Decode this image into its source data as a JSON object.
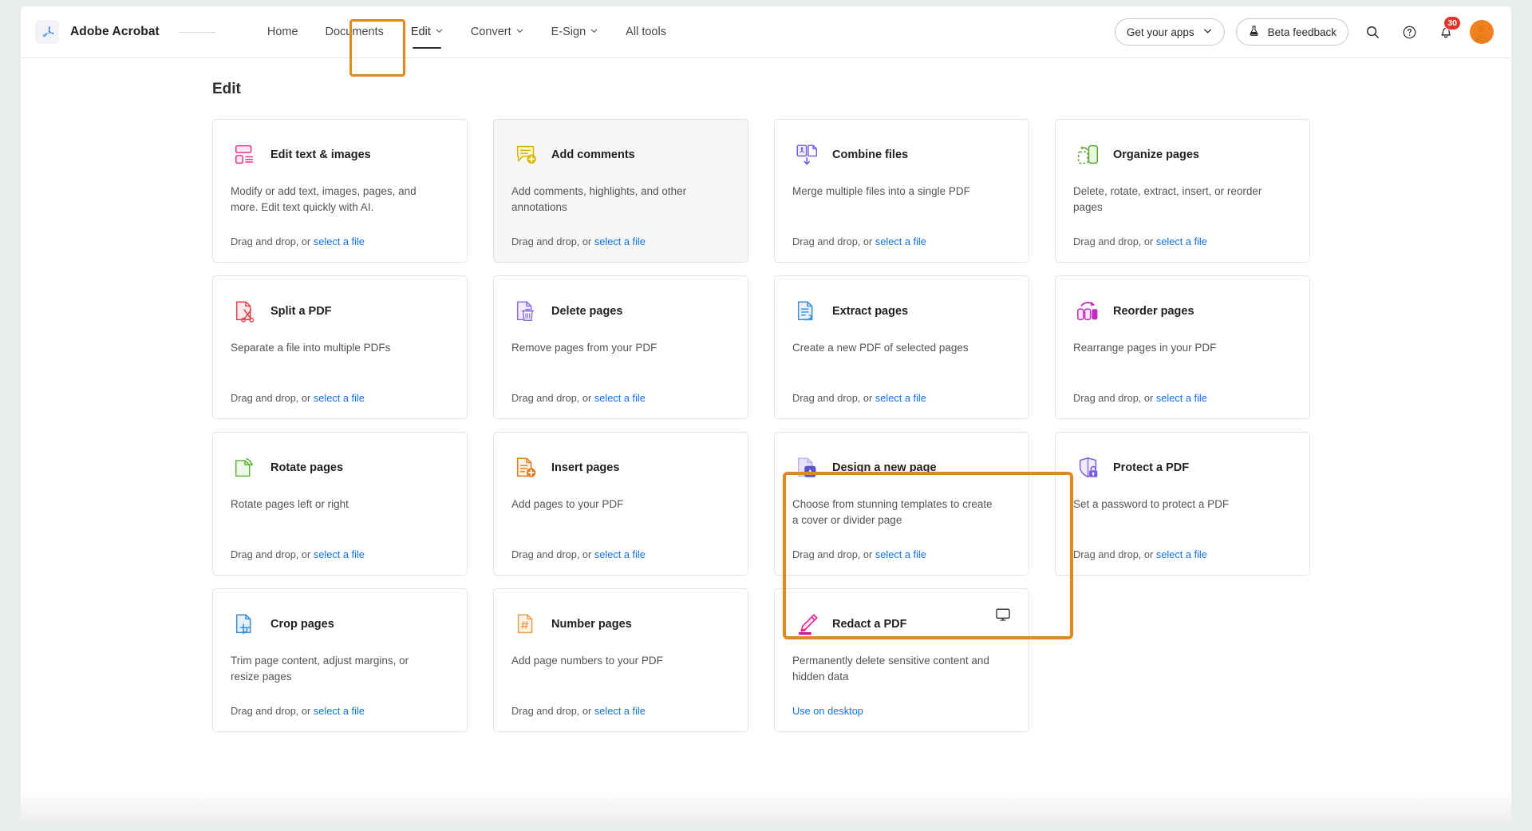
{
  "header": {
    "brand": "Adobe Acrobat",
    "logo_icon": "acrobat-logo-icon",
    "nav": [
      {
        "label": "Home",
        "has_chevron": false,
        "active": false
      },
      {
        "label": "Documents",
        "has_chevron": false,
        "active": false
      },
      {
        "label": "Edit",
        "has_chevron": true,
        "active": true
      },
      {
        "label": "Convert",
        "has_chevron": true,
        "active": false
      },
      {
        "label": "E-Sign",
        "has_chevron": true,
        "active": false
      },
      {
        "label": "All tools",
        "has_chevron": false,
        "active": false
      }
    ],
    "get_apps_label": "Get your apps",
    "get_apps_icon": "chevron-down-icon",
    "beta_feedback_label": "Beta feedback",
    "beta_feedback_icon": "flask-icon",
    "search_icon": "search-icon",
    "help_icon": "help-circle-icon",
    "bell_icon": "notification-bell-icon",
    "notification_count": "30",
    "avatar_icon": "user-avatar-icon"
  },
  "main": {
    "title": "Edit",
    "drag_prefix": "Drag and drop, or ",
    "select_file_label": "select a file",
    "cards": [
      {
        "title": "Edit text & images",
        "desc": "Modify or add text, images, pages, and more. Edit text quickly with AI.",
        "icon": "edit-text-images-icon",
        "color": "#e8368f",
        "footer_type": "drag",
        "hovered": false,
        "highlighted": false
      },
      {
        "title": "Add comments",
        "desc": "Add comments, highlights, and other annotations",
        "icon": "add-comments-icon",
        "color": "#d9b500",
        "footer_type": "drag",
        "hovered": true,
        "highlighted": false
      },
      {
        "title": "Combine files",
        "desc": "Merge multiple files into a single PDF",
        "icon": "combine-files-icon",
        "color": "#6b5ce7",
        "footer_type": "drag",
        "hovered": false,
        "highlighted": false
      },
      {
        "title": "Organize pages",
        "desc": "Delete, rotate, extract, insert, or reorder pages",
        "icon": "organize-pages-icon",
        "color": "#5aa832",
        "footer_type": "drag",
        "hovered": false,
        "highlighted": false
      },
      {
        "title": "Split a PDF",
        "desc": "Separate a file into multiple PDFs",
        "icon": "split-pdf-icon",
        "color": "#e0434f",
        "footer_type": "drag",
        "hovered": false,
        "highlighted": false
      },
      {
        "title": "Delete pages",
        "desc": "Remove pages from your PDF",
        "icon": "delete-pages-icon",
        "color": "#8b6fe0",
        "footer_type": "drag",
        "hovered": false,
        "highlighted": false
      },
      {
        "title": "Extract pages",
        "desc": "Create a new PDF of selected pages",
        "icon": "extract-pages-icon",
        "color": "#3a8fd8",
        "footer_type": "drag",
        "hovered": false,
        "highlighted": false
      },
      {
        "title": "Reorder pages",
        "desc": "Rearrange pages in your PDF",
        "icon": "reorder-pages-icon",
        "color": "#c32cc3",
        "footer_type": "drag",
        "hovered": false,
        "highlighted": false
      },
      {
        "title": "Rotate pages",
        "desc": "Rotate pages left or right",
        "icon": "rotate-pages-icon",
        "color": "#63b23c",
        "footer_type": "drag",
        "hovered": false,
        "highlighted": false
      },
      {
        "title": "Insert pages",
        "desc": "Add pages to your PDF",
        "icon": "insert-pages-icon",
        "color": "#e07b1e",
        "footer_type": "drag",
        "hovered": false,
        "highlighted": false
      },
      {
        "title": "Design a new page",
        "desc": "Choose from stunning templates to create a cover or divider page",
        "icon": "design-new-page-icon",
        "color": "#5b52d6",
        "footer_type": "drag",
        "hovered": false,
        "highlighted": true
      },
      {
        "title": "Protect a PDF",
        "desc": "Set a password to protect a PDF",
        "icon": "protect-pdf-icon",
        "color": "#7a5ee0",
        "footer_type": "drag",
        "hovered": false,
        "highlighted": false
      },
      {
        "title": "Crop pages",
        "desc": "Trim page content, adjust margins, or resize pages",
        "icon": "crop-pages-icon",
        "color": "#3a8fd8",
        "footer_type": "drag",
        "hovered": false,
        "highlighted": false
      },
      {
        "title": "Number pages",
        "desc": "Add page numbers to your PDF",
        "icon": "number-pages-icon",
        "color": "#e9a14b",
        "footer_type": "drag",
        "hovered": false,
        "highlighted": false
      },
      {
        "title": "Redact a PDF",
        "desc": "Permanently delete sensitive content and hidden data",
        "icon": "redact-pdf-icon",
        "color": "#e2238f",
        "footer_type": "desktop",
        "desktop_label": "Use on desktop",
        "desktop_icon": "monitor-icon",
        "hovered": false,
        "highlighted": false
      }
    ]
  },
  "colors": {
    "accent_orange": "#e8861e",
    "link_blue": "#1473e6",
    "badge_red": "#e3342a",
    "avatar_orange": "#ef8121"
  }
}
